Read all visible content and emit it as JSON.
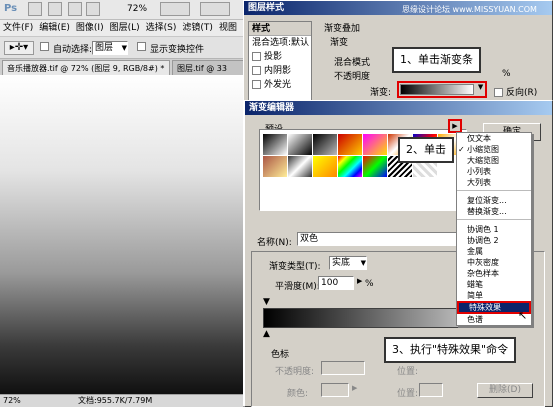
{
  "photoshop": {
    "logo": "Ps",
    "zoom": "72%",
    "menu": [
      "文件(F)",
      "编辑(E)",
      "图像(I)",
      "图层(L)",
      "选择(S)",
      "滤镜(T)",
      "视图(V)"
    ],
    "options": {
      "auto_select_label": "自动选择:",
      "auto_select_value": "图层",
      "show_transform_label": "显示变换控件"
    },
    "doc_tab_active": "音乐播放器.tif @ 72% (图层 9, RGB/8#) *",
    "doc_tab_second": "图层.tif @ 33",
    "status_zoom": "72%",
    "status_doc": "文档:955.7K/7.79M"
  },
  "watermark": "思缘设计论坛 www.MISSYUAN.COM",
  "layer_style": {
    "title": "图层样式",
    "left_items": [
      "样式",
      "混合选项:默认",
      "投影",
      "内阴影",
      "外发光"
    ],
    "section_title": "渐变叠加",
    "group_title": "渐变",
    "blend_label": "混合模式",
    "opacity_label": "不透明度",
    "opacity_unit": "%",
    "gradient_label": "渐变:",
    "reverse_label": "反向(R)"
  },
  "gradient_editor": {
    "title": "渐变编辑器",
    "presets_label": "预设",
    "ok_button": "确定",
    "name_label": "名称(N):",
    "name_value": "双色",
    "type_label": "渐变类型(T):",
    "type_value": "实底",
    "smooth_label": "平滑度(M):",
    "smooth_value": "100",
    "smooth_unit": "%",
    "stops_group": "色标",
    "stop_opacity_label": "不透明度:",
    "stop_color_label": "颜色:",
    "position_label": "位置:",
    "delete_button": "删除(D)"
  },
  "menu_items": [
    "仅文本",
    "小缩览图",
    "大缩览图",
    "小列表",
    "大列表",
    "复位渐变...",
    "替换渐变...",
    "协调色 1",
    "协调色 2",
    "金属",
    "中灰密度",
    "杂色样本",
    "蜡笔",
    "简单",
    "特殊效果",
    "色谱"
  ],
  "menu_checked": "小缩览图",
  "menu_highlight": "特殊效果",
  "callouts": {
    "step1": "1、单击渐变条",
    "step2": "2、单击",
    "step3": "3、执行\"特殊效果\"命令"
  },
  "colors": {
    "title_blue": "#0a246a",
    "highlight": "#0a246a",
    "callout_red": "#e00000"
  }
}
